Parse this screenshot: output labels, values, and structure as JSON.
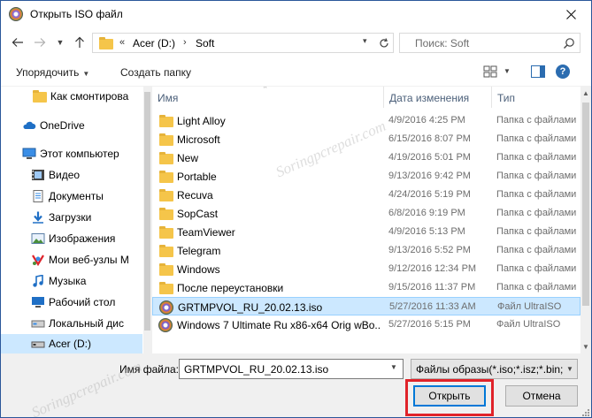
{
  "window": {
    "title": "Открыть ISO файл"
  },
  "nav": {
    "breadcrumb": {
      "chevrons": "«",
      "drive": "Acer (D:)",
      "separator": "›",
      "folder": "Soft"
    },
    "search_placeholder": "Поиск: Soft"
  },
  "toolbar": {
    "organize_label": "Упорядочить",
    "new_folder_label": "Создать папку"
  },
  "sidebar": {
    "items": [
      {
        "label": "Как смонтирова",
        "icon": "folder-icon"
      },
      {
        "label": "OneDrive",
        "icon": "cloud-icon"
      },
      {
        "label": "Этот компьютер",
        "icon": "computer-icon"
      },
      {
        "label": "Видео",
        "icon": "video-icon"
      },
      {
        "label": "Документы",
        "icon": "documents-icon"
      },
      {
        "label": "Загрузки",
        "icon": "downloads-icon"
      },
      {
        "label": "Изображения",
        "icon": "pictures-icon"
      },
      {
        "label": "Мои веб-узлы M",
        "icon": "network-icon"
      },
      {
        "label": "Музыка",
        "icon": "music-icon"
      },
      {
        "label": "Рабочий стол",
        "icon": "desktop-icon"
      },
      {
        "label": "Локальный дис",
        "icon": "drive-icon"
      },
      {
        "label": "Acer (D:)",
        "icon": "drive-icon"
      }
    ],
    "selected": "Acer (D:)"
  },
  "columns": {
    "name": "Имя",
    "date": "Дата изменения",
    "type": "Тип"
  },
  "files": [
    {
      "name": "Light Alloy",
      "date": "4/9/2016 4:25 PM",
      "type": "Папка с файлами",
      "icon": "folder-icon"
    },
    {
      "name": "Microsoft",
      "date": "6/15/2016 8:07 PM",
      "type": "Папка с файлами",
      "icon": "folder-icon"
    },
    {
      "name": "New",
      "date": "4/19/2016 5:01 PM",
      "type": "Папка с файлами",
      "icon": "folder-icon"
    },
    {
      "name": "Portable",
      "date": "9/13/2016 9:42 PM",
      "type": "Папка с файлами",
      "icon": "folder-icon"
    },
    {
      "name": "Recuva",
      "date": "4/24/2016 5:19 PM",
      "type": "Папка с файлами",
      "icon": "folder-icon"
    },
    {
      "name": "SopCast",
      "date": "6/8/2016 9:19 PM",
      "type": "Папка с файлами",
      "icon": "folder-icon"
    },
    {
      "name": "TeamViewer",
      "date": "4/9/2016 5:13 PM",
      "type": "Папка с файлами",
      "icon": "folder-icon"
    },
    {
      "name": "Telegram",
      "date": "9/13/2016 5:52 PM",
      "type": "Папка с файлами",
      "icon": "folder-icon"
    },
    {
      "name": "Windows",
      "date": "9/12/2016 12:34 PM",
      "type": "Папка с файлами",
      "icon": "folder-icon"
    },
    {
      "name": "После переустановки",
      "date": "9/15/2016 11:37 PM",
      "type": "Папка с файлами",
      "icon": "folder-icon"
    },
    {
      "name": "GRTMPVOL_RU_20.02.13.iso",
      "date": "5/27/2016 11:33 AM",
      "type": "Файл UltraISO",
      "icon": "iso-disc-icon"
    },
    {
      "name": "Windows 7 Ultimate Ru x86-x64 Orig wBo...",
      "date": "5/27/2016 5:15 PM",
      "type": "Файл UltraISO",
      "icon": "iso-disc-icon"
    }
  ],
  "selected_file": "GRTMPVOL_RU_20.02.13.iso",
  "footer": {
    "filename_label": "Имя файла:",
    "filename_value": "GRTMPVOL_RU_20.02.13.iso",
    "filter_value": "Файлы образы(*.iso;*.isz;*.bin;",
    "open_label": "Открыть",
    "cancel_label": "Отмена"
  },
  "watermark": "Soringpcrepair.com",
  "colors": {
    "selection": "#cce8ff",
    "highlight_frame": "#e0232a",
    "accent": "#0078d7"
  }
}
